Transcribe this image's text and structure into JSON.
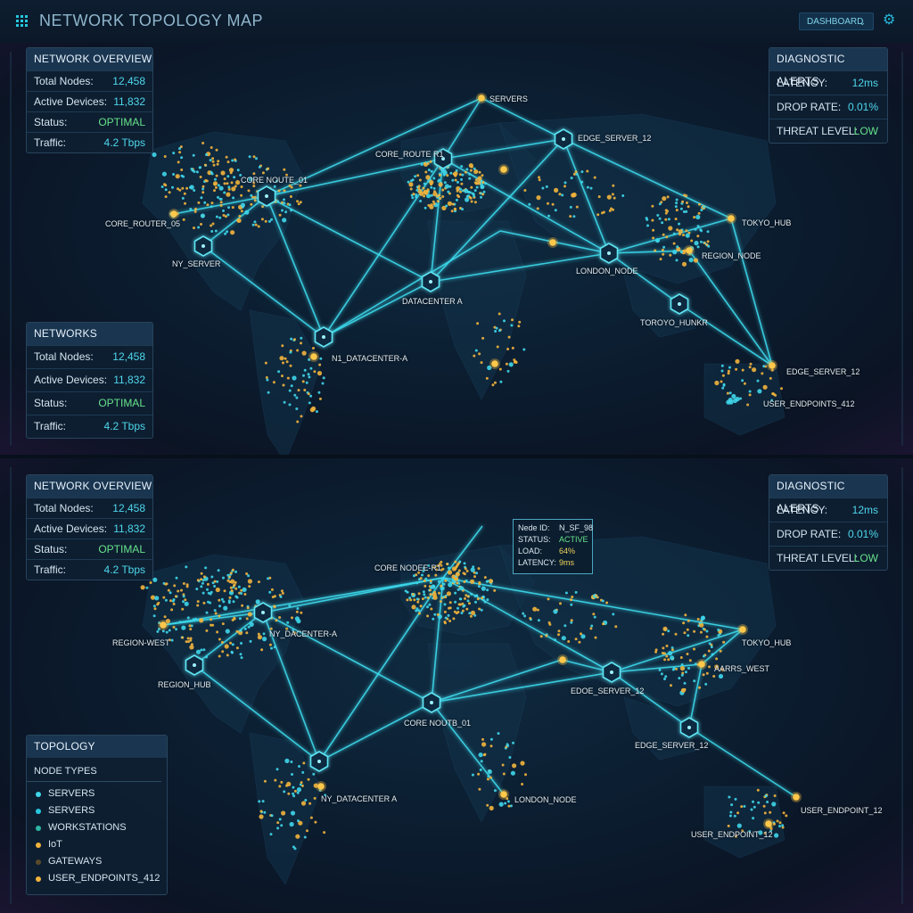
{
  "app": {
    "title": "NETWORK TOPOLOGY MAP",
    "dashboard_label": "DASHBOARD"
  },
  "colors": {
    "accent": "#27c7e0",
    "node_yellow": "#f2b43c",
    "ok_green": "#67e28a",
    "panel_header": "#1a3550"
  },
  "icons": {
    "menu": "grid-icon",
    "settings": "gear-icon",
    "dropdown": "chevron-down-icon",
    "node": "hexagon-node-icon"
  },
  "top": {
    "overview": {
      "title": "NETWORK OVERVIEW",
      "rows": [
        {
          "label": "Total Nodes:",
          "value": "12,458"
        },
        {
          "label": "Active Devices:",
          "value": "11,832"
        },
        {
          "label": "Status:",
          "value": "OPTIMAL"
        },
        {
          "label": "Traffic:",
          "value": "4.2 Tbps"
        }
      ]
    },
    "networks": {
      "title": "NETWORKS",
      "rows": [
        {
          "label": "Total Nodes:",
          "value": "12,458"
        },
        {
          "label": "Active Devices:",
          "value": "11,832"
        },
        {
          "label": "Status:",
          "value": "OPTIMAL"
        },
        {
          "label": "Traffic:",
          "value": "4.2 Tbps"
        }
      ]
    },
    "alerts": {
      "title": "DIAGNOSTIC ALERTS",
      "rows": [
        {
          "label": "LATENCY:",
          "value": "12ms"
        },
        {
          "label": "DROP RATE:",
          "value": "0.01%"
        },
        {
          "label": "THREAT LEVEL:",
          "value": "LOW"
        }
      ]
    },
    "labels": {
      "servers": "SERVERS",
      "edge_server_12_a": "EDGE_SERVER_12",
      "core_route_r1": "CORE_ROUTE R1",
      "core_noute_01": "CORE NOUTE_01",
      "core_router_05": "CORE_ROUTER_05",
      "ny_server": "NY_SERVER",
      "tokyo_hub": "TOKYO_HUB",
      "region_node": "REGION_NODE",
      "london_node": "LONDON_NODE",
      "datacenter_a": "DATACENTER A",
      "toroyo_hunkr": "TOROYO_HUNKR",
      "n1_datacenter_a": "N1_DATACENTER-A",
      "edge_server_12_b": "EDGE_SERVER_12",
      "user_endpoints_412": "USER_ENDPOINTS_412"
    }
  },
  "bottom": {
    "overview": {
      "title": "NETWORK OVERVIEW",
      "rows": [
        {
          "label": "Total Nodes:",
          "value": "12,458"
        },
        {
          "label": "Active Devices:",
          "value": "11,832"
        },
        {
          "label": "Status:",
          "value": "OPTIMAL"
        },
        {
          "label": "Traffic:",
          "value": "4.2 Tbps"
        }
      ]
    },
    "alerts": {
      "title": "DIAGNOSTIC ALERTS",
      "rows": [
        {
          "label": "LATENCY:",
          "value": "12ms"
        },
        {
          "label": "DROP RATE:",
          "value": "0.01%"
        },
        {
          "label": "THREAT LEVEL:",
          "value": "LOW"
        }
      ]
    },
    "tooltip": {
      "rows": [
        {
          "label": "Nede ID:",
          "value": "N_SF_98"
        },
        {
          "label": "STATUS:",
          "value": "ACTIVE"
        },
        {
          "label": "LOAD:",
          "value": "64%"
        },
        {
          "label": "LATENCY:",
          "value": "9ms"
        }
      ]
    },
    "topology": {
      "title": "TOPOLOGY",
      "subtitle": "NODE TYPES",
      "items": [
        {
          "label": "SERVERS",
          "color": "#3fd6ea"
        },
        {
          "label": "SERVERS",
          "color": "#27c7e0"
        },
        {
          "label": "WORKSTATIONS",
          "color": "#2fb7a6"
        },
        {
          "label": "IoT",
          "color": "#f2b43c"
        },
        {
          "label": "GATEWAYS",
          "color": "#5b4a2a"
        },
        {
          "label": "USER_ENDPOINTS_412",
          "color": "#f2b43c"
        }
      ]
    },
    "labels": {
      "core_nodee_r1": "CORE NODEE-R1",
      "region_west": "REGION-WEST",
      "ny_dacenter_a": "NY_DACENTER-A",
      "region_hub": "REGION_HUB",
      "tokyo_hub": "TOKYO_HUB",
      "aarrs_west": "AARRS_WEST",
      "edoe_server_12": "EDOE_SERVER_12",
      "core_noutb_01": "CORE NOUTB_01",
      "edge_server_12": "EDGE_SERVER_12",
      "ny_datacenter_a": "NY_DATACENTER A",
      "london_node": "LONDON_NODE",
      "user_endpoint_12_a": "USER_ENDPOINT_12",
      "user_endpoint_12_b": "USER_ENDPOINT_12"
    }
  }
}
